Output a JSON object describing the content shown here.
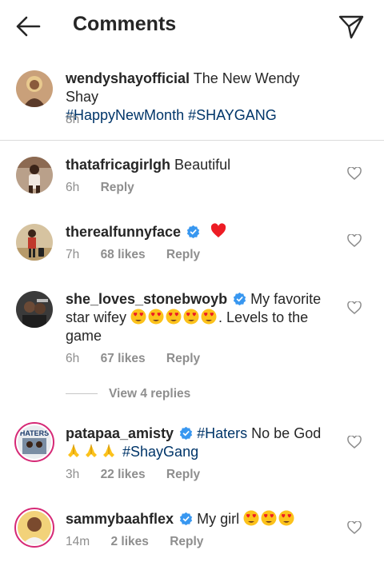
{
  "header": {
    "title": "Comments"
  },
  "caption": {
    "username": "wendyshayofficial",
    "text": "The New Wendy Shay",
    "hashtags": "#HappyNewMonth #SHAYGANG",
    "time": "8h"
  },
  "comments": [
    {
      "username": "thatafricagirlgh",
      "text": "Beautiful",
      "time": "6h",
      "likes": "",
      "reply": "Reply"
    },
    {
      "username": "therealfunnyface",
      "text": "",
      "time": "7h",
      "likes": "68 likes",
      "reply": "Reply"
    },
    {
      "username": "she_loves_stonebwoyb",
      "text_a": "My favorite",
      "text_b": "star wifey",
      "text_c": ". Levels to the",
      "text_d": "game",
      "time": "6h",
      "likes": "67 likes",
      "reply": "Reply"
    },
    {
      "username": "patapaa_amisty",
      "hashtag_a": "#Haters",
      "text": "No be God",
      "hashtag_b": "#ShayGang",
      "time": "3h",
      "likes": "22 likes",
      "reply": "Reply"
    },
    {
      "username": "sammybaahflex",
      "text": "My girl",
      "time": "14m",
      "likes": "2 likes",
      "reply": "Reply"
    }
  ],
  "view_replies": "View 4 replies",
  "icons": {
    "back": "arrow-left-icon",
    "send": "paper-plane-icon",
    "like": "heart-outline-icon",
    "verified": "verified-badge-icon"
  },
  "colors": {
    "hashtag": "#003569",
    "verified": "#3897f0",
    "heart": "#ed4956",
    "meta": "#8e8e8e"
  }
}
